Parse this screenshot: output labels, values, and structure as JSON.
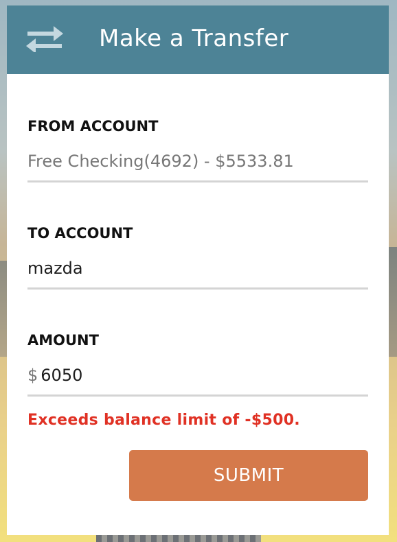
{
  "header": {
    "title": "Make a Transfer",
    "icon": "transfer-arrows-icon"
  },
  "from_account": {
    "label": "FROM ACCOUNT",
    "value": "Free Checking(4692) - $5533.81"
  },
  "to_account": {
    "label": "TO ACCOUNT",
    "value": "mazda"
  },
  "amount": {
    "label": "AMOUNT",
    "currency_symbol": "$",
    "value": "6050"
  },
  "error_message": "Exceeds balance limit of -$500.",
  "submit_label": "SUBMIT",
  "colors": {
    "header": "#4d8396",
    "submit": "#d57a4b",
    "error": "#e03124"
  }
}
